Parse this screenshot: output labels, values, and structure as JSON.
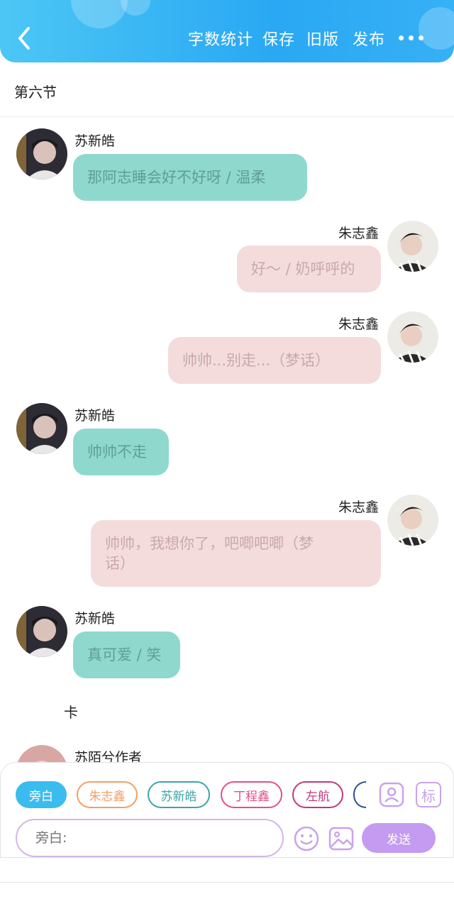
{
  "header": {
    "menu": [
      "字数统计",
      "保存",
      "旧版",
      "发布"
    ]
  },
  "section": {
    "title": "第六节"
  },
  "messages": [
    {
      "side": "left",
      "name": "苏新皓",
      "text": "那阿志睡会好不好呀 / 温柔"
    },
    {
      "side": "right",
      "name": "朱志鑫",
      "text": "好～ / 奶呼呼的"
    },
    {
      "side": "right",
      "name": "朱志鑫",
      "text": "帅帅...别走...（梦话）"
    },
    {
      "side": "left",
      "name": "苏新皓",
      "text": "帅帅不走"
    },
    {
      "side": "right",
      "name": "朱志鑫",
      "text": "帅帅，我想你了，吧唧吧唧（梦",
      "text2": "话）"
    },
    {
      "side": "left",
      "name": "苏新皓",
      "text": "真可爱 / 笑"
    }
  ],
  "narration": "卡",
  "partial_name": "苏陌兮作者",
  "roles": [
    {
      "label": "旁白",
      "color": "#3bbcef",
      "filled": true
    },
    {
      "label": "朱志鑫",
      "color": "#f0a066",
      "filled": false
    },
    {
      "label": "苏新皓",
      "color": "#3aa5a8",
      "filled": false
    },
    {
      "label": "丁程鑫",
      "color": "#e0508a",
      "filled": false
    },
    {
      "label": "左航",
      "color": "#c2387e",
      "filled": false
    }
  ],
  "input": {
    "placeholder": "旁白:"
  },
  "send_label": "发送",
  "icons": {
    "back": "back-arrow-icon",
    "more": "more-dots-icon",
    "add_role": "contact-card-icon",
    "tag": "tag-icon",
    "emoji": "emoji-icon",
    "image": "image-icon"
  },
  "tag_label": "标",
  "colors": {
    "header_start": "#4cc7f5",
    "header_end": "#2aa8f3",
    "left_bubble": "#8fd8cd",
    "right_bubble": "#f4dcdc",
    "accent_purple": "#c49bf0"
  }
}
